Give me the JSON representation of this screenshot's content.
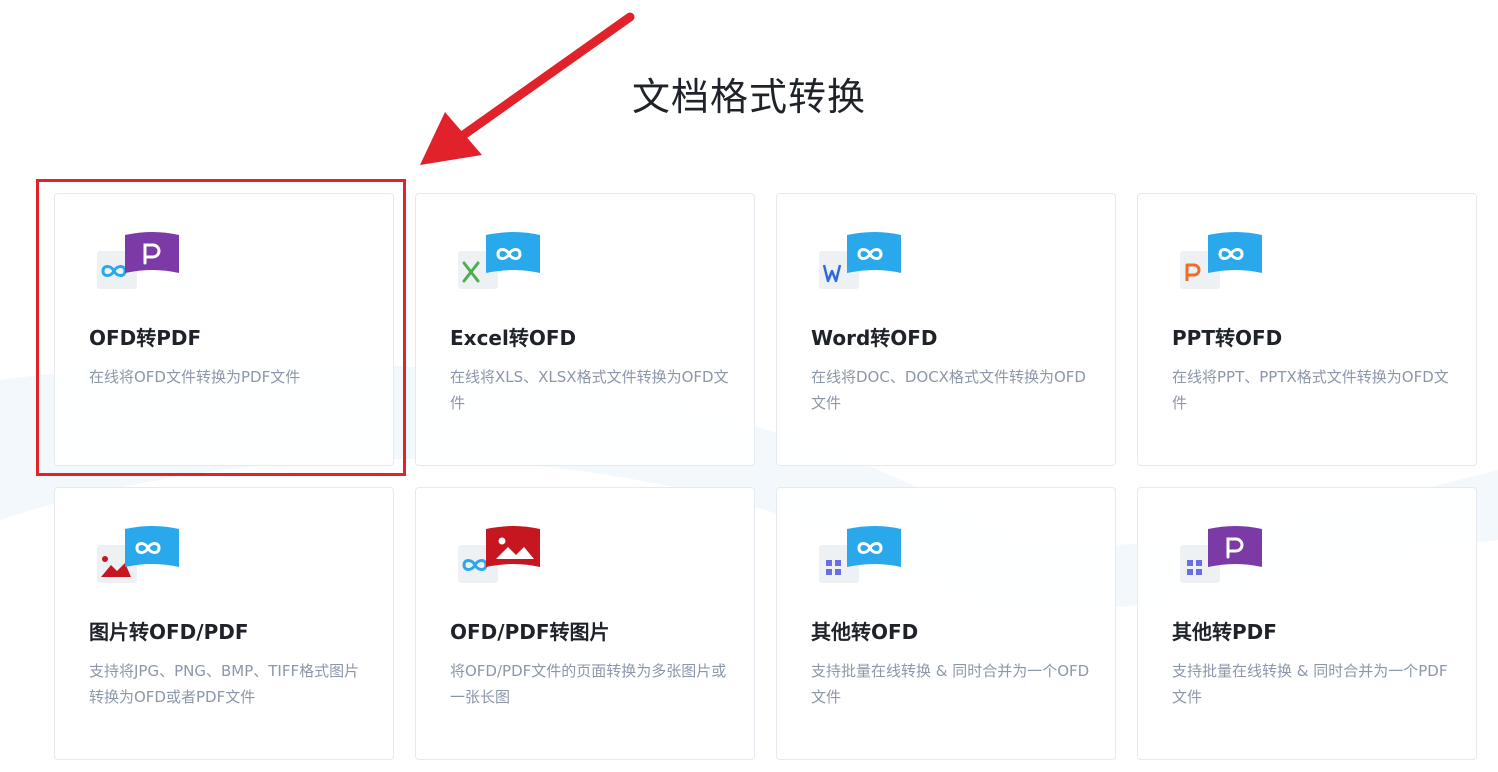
{
  "page": {
    "title": "文档格式转换"
  },
  "colors": {
    "ofd_blue": "#29a8ec",
    "pdf_purple": "#7b3aa6",
    "image_red": "#c6161f",
    "excel_green": "#4caf50",
    "word_blue": "#2f6bd4",
    "ppt_orange": "#ef6c2b",
    "grid_purple": "#6b6de3",
    "annotation_red": "#e2222a"
  },
  "cards": [
    {
      "title": "OFD转PDF",
      "desc": "在线将OFD文件转换为PDF文件",
      "icon": "ofd-to-pdf-icon",
      "highlighted": true
    },
    {
      "title": "Excel转OFD",
      "desc": "在线将XLS、XLSX格式文件转换为OFD文件",
      "icon": "excel-to-ofd-icon"
    },
    {
      "title": "Word转OFD",
      "desc": "在线将DOC、DOCX格式文件转换为OFD文件",
      "icon": "word-to-ofd-icon"
    },
    {
      "title": "PPT转OFD",
      "desc": "在线将PPT、PPTX格式文件转换为OFD文件",
      "icon": "ppt-to-ofd-icon"
    },
    {
      "title": "图片转OFD/PDF",
      "desc": "支持将JPG、PNG、BMP、TIFF格式图片转换为OFD或者PDF文件",
      "icon": "image-to-ofd-pdf-icon"
    },
    {
      "title": "OFD/PDF转图片",
      "desc": "将OFD/PDF文件的页面转换为多张图片或一张长图",
      "icon": "ofd-pdf-to-image-icon"
    },
    {
      "title": "其他转OFD",
      "desc": "支持批量在线转换 & 同时合并为一个OFD文件",
      "icon": "other-to-ofd-icon"
    },
    {
      "title": "其他转PDF",
      "desc": "支持批量在线转换 & 同时合并为一个PDF文件",
      "icon": "other-to-pdf-icon"
    }
  ]
}
